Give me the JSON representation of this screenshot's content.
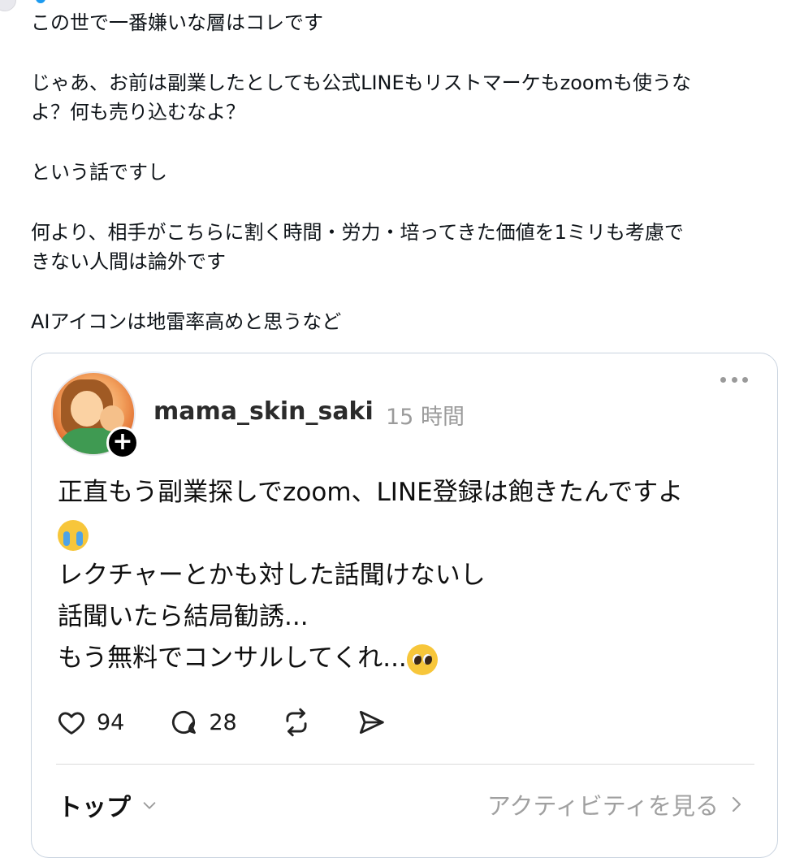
{
  "post": {
    "lines": [
      "この世で一番嫌いな層はコレです",
      "",
      "じゃあ、お前は副業したとしても公式LINEもリストマーケもzoomも使うな",
      "よ？何も売り込むなよ？",
      "",
      "という話ですし",
      "",
      "何より、相手がこちらに割く時間・労力・培ってきた価値を1ミリも考慮で",
      "きない人間は論外です",
      "",
      "AIアイコンは地雷率高めと思うなど"
    ]
  },
  "quote": {
    "username": "mama_skin_saki",
    "time": "15 時間",
    "body": {
      "line1": "正直もう副業探しでzoom、LINE登録は飽きたんですよ",
      "line2": "レクチャーとかも対した話聞けないし",
      "line3": "話聞いたら結局勧誘...",
      "line4": "もう無料でコンサルしてくれ..."
    },
    "actions": {
      "likes": "94",
      "comments": "28"
    },
    "footer": {
      "sort_label": "トップ",
      "activity_label": "アクティビティを見る"
    },
    "icons": [
      "heart-icon",
      "comment-icon",
      "repost-icon",
      "share-icon",
      "more-icon",
      "plus-icon",
      "chevron-down-icon",
      "chevron-right-icon",
      "loudly-crying-emoji",
      "pleading-emoji"
    ]
  },
  "colors": {
    "border": "#c9d3df",
    "muted": "#9b9b9b",
    "text": "#0f1419"
  }
}
